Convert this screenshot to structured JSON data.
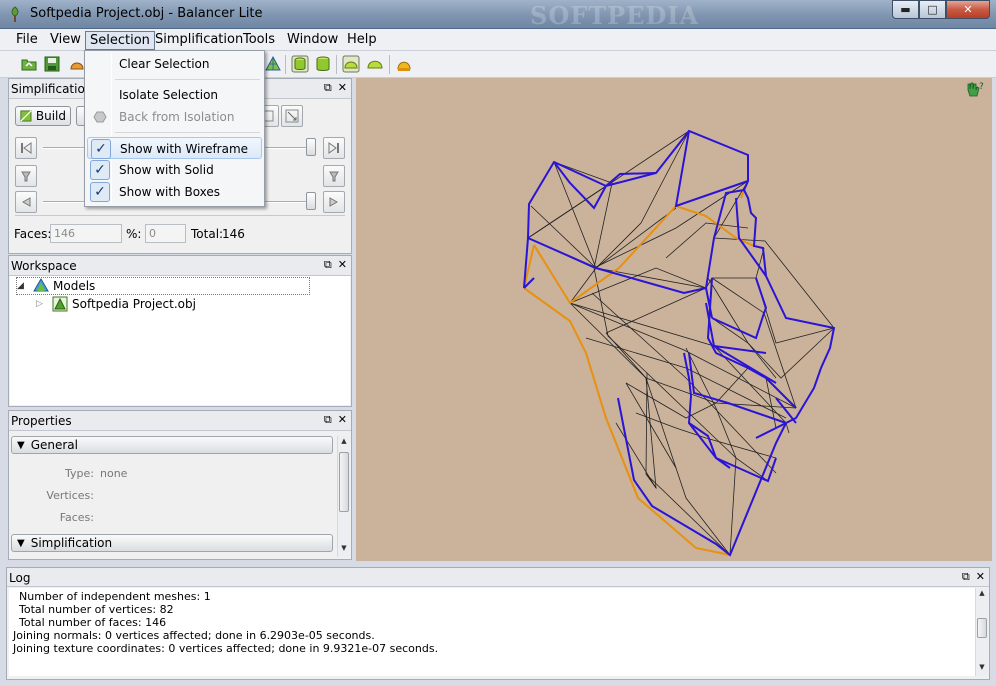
{
  "window": {
    "title": "Softpedia Project.obj - Balancer Lite",
    "watermark": "SOFTPEDIA",
    "controls": [
      "minimize",
      "maximize",
      "close"
    ]
  },
  "menubar": {
    "items": [
      {
        "label": "File"
      },
      {
        "label": "View"
      },
      {
        "label": "Selection",
        "open": true
      },
      {
        "label": "Simplification"
      },
      {
        "label": "Tools"
      },
      {
        "label": "Window"
      },
      {
        "label": "Help"
      }
    ]
  },
  "selection_menu": {
    "items": [
      {
        "label": "Clear Selection",
        "enabled": true
      },
      {
        "label": "Isolate Selection",
        "enabled": true
      },
      {
        "label": "Back from Isolation",
        "enabled": false
      },
      {
        "label": "Show with Wireframe",
        "checked": true,
        "highlighted": true
      },
      {
        "label": "Show with Solid",
        "checked": true
      },
      {
        "label": "Show with Boxes",
        "checked": true
      }
    ]
  },
  "simplification_panel": {
    "title": "Simplification",
    "build_label": "Build",
    "faces_label": "Faces:",
    "faces_value": "146",
    "percent_label": "%:",
    "percent_value": "0",
    "total_label": "Total:",
    "total_value": "146"
  },
  "workspace_panel": {
    "title": "Workspace",
    "root_label": "Models",
    "child_label": "Softpedia Project.obj"
  },
  "properties_panel": {
    "title": "Properties",
    "general_label": "General",
    "type_label": "Type:",
    "type_value": "none",
    "vertices_label": "Vertices:",
    "faces_label": "Faces:",
    "simplification_label": "Simplification"
  },
  "log_panel": {
    "title": "Log",
    "lines": [
      "Number of independent meshes: 1",
      "Total number of vertices: 82",
      "Total number of faces: 146",
      "Joining normals: 0 vertices affected; done in 6.2903e-05 seconds.",
      "Joining texture coordinates: 0 vertices affected; done in 9.9321e-07 seconds."
    ]
  },
  "colors": {
    "viewport_bg": "#cbb29b",
    "wireframe_outline": "#2a14d6",
    "boundary_edge": "#e8900f",
    "mesh_lines": "#222222"
  }
}
